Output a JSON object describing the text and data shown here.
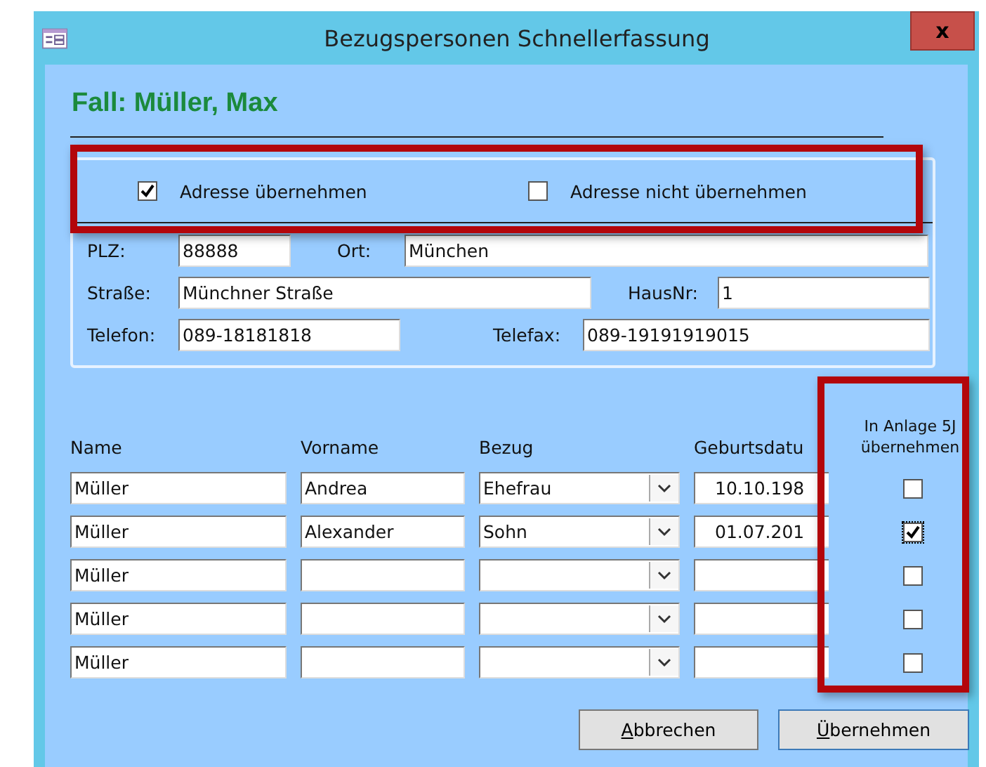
{
  "window": {
    "title": "Bezugspersonen Schnellerfassung",
    "close": "x"
  },
  "heading": "Fall: Müller, Max",
  "address_options": [
    {
      "label": "Adresse übernehmen",
      "checked": true
    },
    {
      "label": "Adresse nicht übernehmen",
      "checked": false
    }
  ],
  "address_rows": [
    [
      {
        "label": "PLZ:",
        "value": "88888"
      },
      {
        "label": "Ort:",
        "value": "München"
      }
    ],
    [
      {
        "label": "Straße:",
        "value": "Münchner Straße"
      },
      {
        "label": "HausNr:",
        "value": "1"
      }
    ],
    [
      {
        "label": "Telefon:",
        "value": "089-18181818"
      },
      {
        "label": "Telefax:",
        "value": "089-19191919015"
      }
    ]
  ],
  "table": {
    "columns": [
      "Name",
      "Vorname",
      "Bezug",
      "Geburtsdatu",
      "In Anlage 5J übernehmen"
    ],
    "rows": [
      {
        "name": "Müller",
        "vorname": "Andrea",
        "bezug": "Ehefrau",
        "geburtsdatum": "10.10.198",
        "checked": false
      },
      {
        "name": "Müller",
        "vorname": "Alexander",
        "bezug": "Sohn",
        "geburtsdatum": "01.07.201",
        "checked": true
      },
      {
        "name": "Müller",
        "checked": false
      },
      {
        "name": "Müller",
        "checked": false
      },
      {
        "name": "Müller",
        "checked": false
      }
    ]
  },
  "buttons": [
    "Abbrechen",
    "Übernehmen"
  ]
}
